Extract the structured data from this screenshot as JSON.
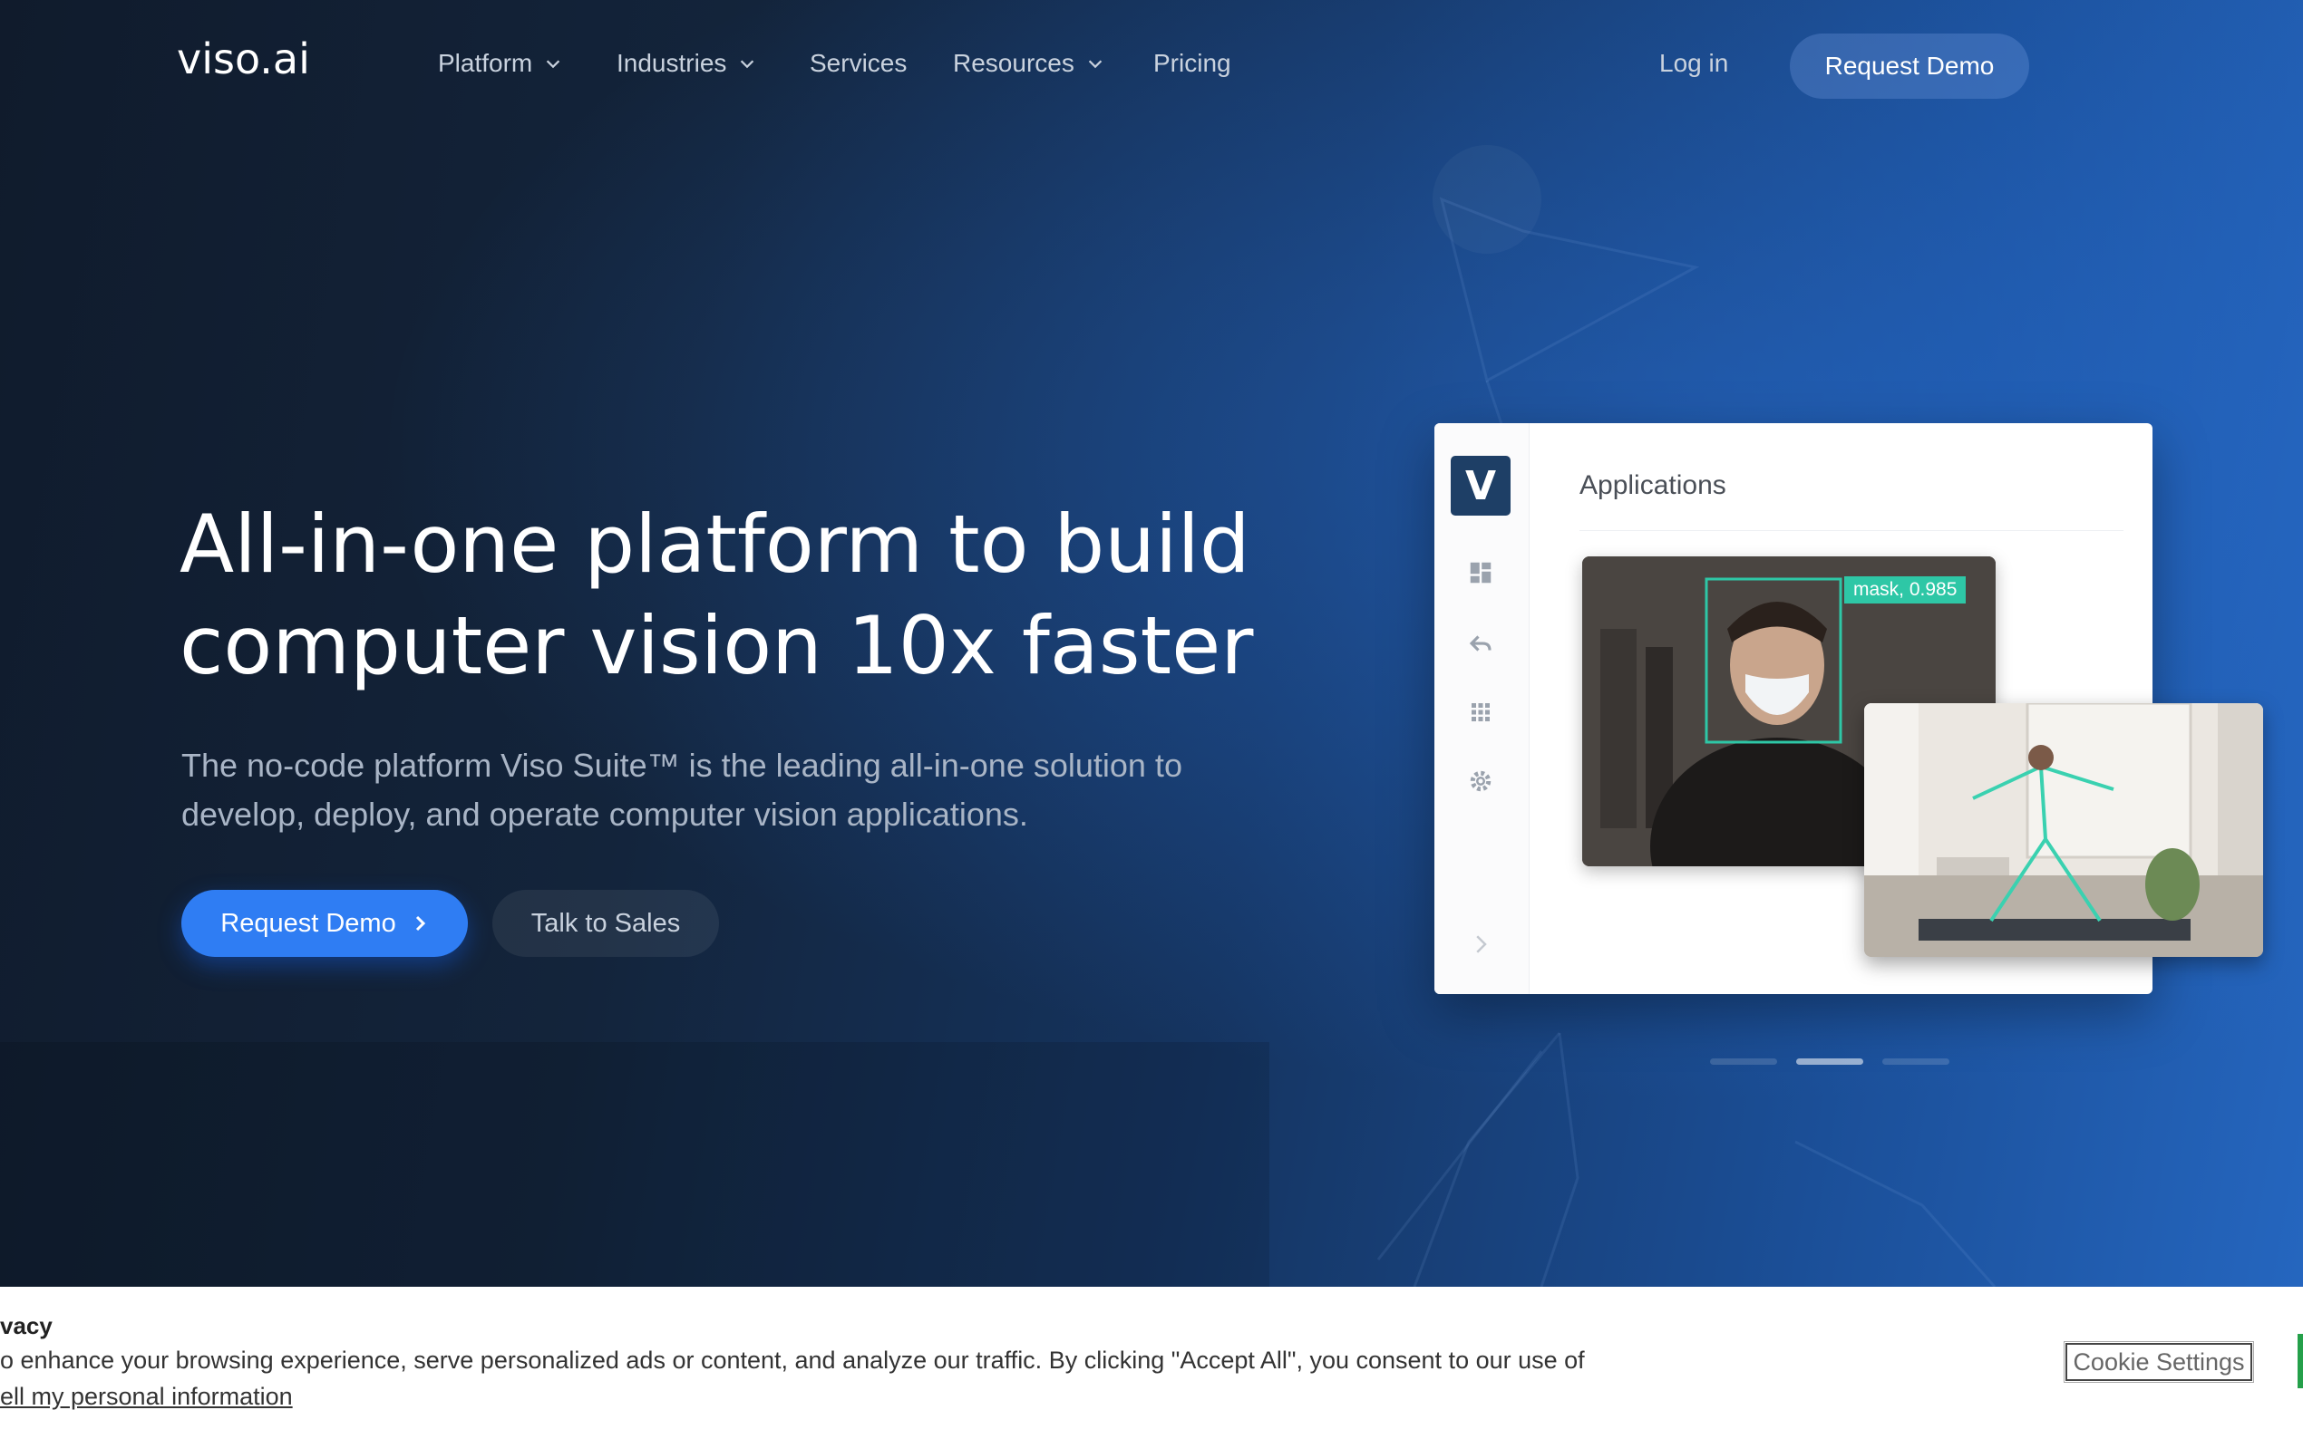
{
  "nav": {
    "logo": "viso.ai",
    "items": [
      {
        "label": "Platform",
        "has_dropdown": true
      },
      {
        "label": "Industries",
        "has_dropdown": true
      },
      {
        "label": "Services",
        "has_dropdown": false
      },
      {
        "label": "Resources",
        "has_dropdown": true
      },
      {
        "label": "Pricing",
        "has_dropdown": false
      }
    ],
    "login": "Log in",
    "request_demo": "Request Demo"
  },
  "hero": {
    "headline_line1": "All-in-one platform to build",
    "headline_line2": "computer vision 10x faster",
    "subtext": "The no-code platform Viso Suite™ is the leading all-in-one solution to develop, deploy, and operate computer vision applications.",
    "cta_primary": "Request Demo",
    "cta_secondary": "Talk to Sales"
  },
  "mockup": {
    "logo_letter": "V",
    "title": "Applications",
    "detection_label": "mask, 0.985",
    "sidebar_icons": [
      "dashboard-icon",
      "back-arrow-icon",
      "apps-grid-icon",
      "settings-gear-icon",
      "chevron-right-icon"
    ]
  },
  "carousel": {
    "slide_count": 3,
    "active_index": 1
  },
  "cookie_banner": {
    "title": "vacy",
    "text": "o enhance your browsing experience, serve personalized ads or content, and analyze our traffic. By clicking \"Accept All\", you consent to our use of",
    "link": "ell my personal information",
    "settings_button": "Cookie Settings"
  },
  "colors": {
    "primary_blue": "#2f7df3",
    "mask_label_green": "#2ec7a6",
    "accept_green": "#24a04a",
    "app_logo_navy": "#1e3f66"
  }
}
